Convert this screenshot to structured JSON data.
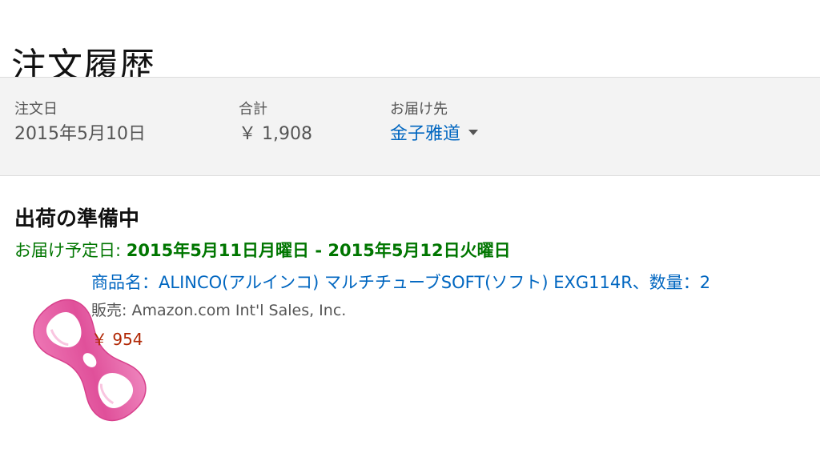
{
  "page": {
    "title": "注文履歴"
  },
  "summary": {
    "order_date_label": "注文日",
    "order_date_value": "2015年5月10日",
    "total_label": "合計",
    "total_value": "￥ 1,908",
    "ship_to_label": "お届け先",
    "ship_to_value": "金子雅道"
  },
  "shipment": {
    "status": "出荷の準備中",
    "delivery_label": "お届け予定日: ",
    "delivery_dates": "2015年5月11日月曜日 - 2015年5月12日火曜日"
  },
  "item": {
    "name": "商品名：ALINCO(アルインコ) マルチチューブSOFT(ソフト) EXG114R、数量：2",
    "seller": "販売: Amazon.com Int'l Sales, Inc.",
    "price": "￥ 954",
    "image_icon": "pink-tube-exerciser-image"
  },
  "colors": {
    "link": "#0066c0",
    "delivery_green": "#007600",
    "price_red": "#b12704",
    "summary_bg": "#f3f3f3",
    "product_pink": "#e0509a"
  }
}
